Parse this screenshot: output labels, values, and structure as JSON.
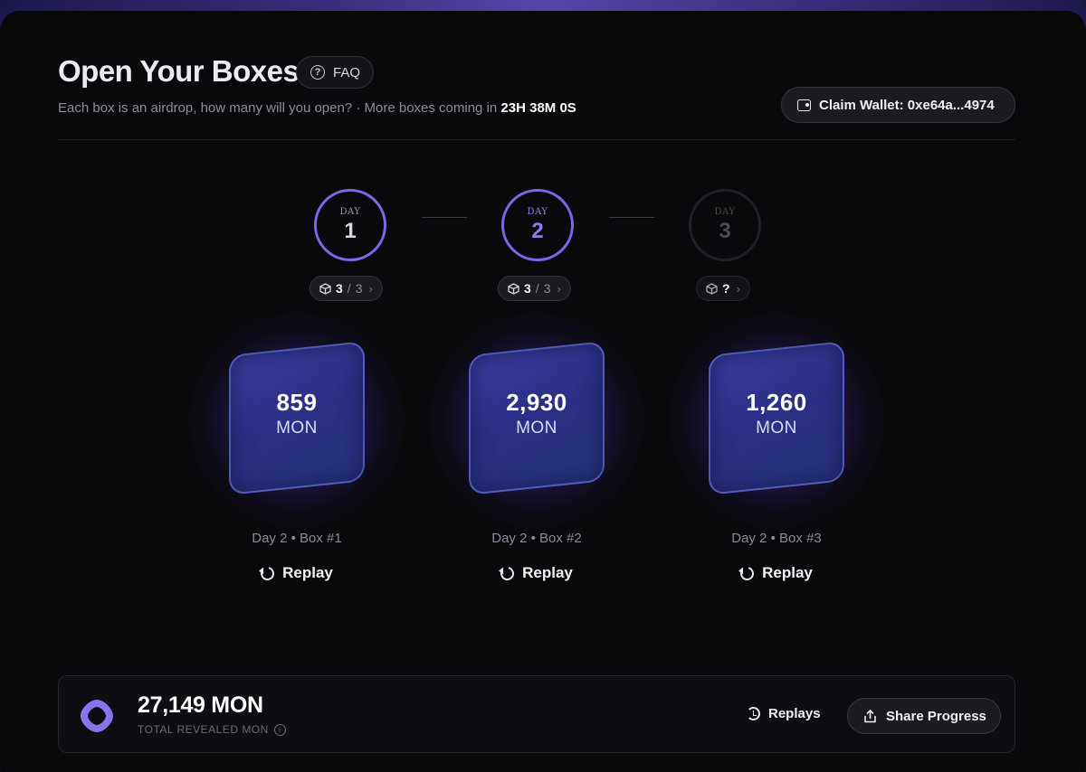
{
  "header": {
    "title": "Open Your Boxes",
    "faq_label": "FAQ",
    "subtitle_prefix": "Each box is an airdrop, how many will you open? · More boxes coming in",
    "countdown": "23H 38M 0S",
    "wallet_label": "Claim Wallet: 0xe64a...4974"
  },
  "days": [
    {
      "label": "DAY",
      "number": "1",
      "opened": "3",
      "separator": "/",
      "total": "3",
      "chevron": "›"
    },
    {
      "label": "DAY",
      "number": "2",
      "opened": "3",
      "separator": "/",
      "total": "3",
      "chevron": "›"
    },
    {
      "label": "DAY",
      "number": "3",
      "opened": "?",
      "separator": "",
      "total": "",
      "chevron": "›"
    }
  ],
  "boxes": [
    {
      "amount": "859",
      "unit": "MON",
      "caption": "Day 2 • Box #1",
      "replay_label": "Replay"
    },
    {
      "amount": "2,930",
      "unit": "MON",
      "caption": "Day 2 • Box #2",
      "replay_label": "Replay"
    },
    {
      "amount": "1,260",
      "unit": "MON",
      "caption": "Day 2 • Box #3",
      "replay_label": "Replay"
    }
  ],
  "footer": {
    "total_amount": "27,149 MON",
    "total_label": "TOTAL REVEALED MON",
    "info_icon_glyph": "i",
    "replays_label": "Replays",
    "share_label": "Share Progress"
  },
  "icons": {
    "faq": "question-circle-icon",
    "wallet": "wallet-icon",
    "box": "cube-icon",
    "replay": "rotate-ccw-icon",
    "replays": "history-icon",
    "share": "share-icon",
    "logo": "monad-logo-icon"
  },
  "colors": {
    "accent": "#7b68e6",
    "background": "#09090c",
    "box_fill": "#2b2f86"
  }
}
